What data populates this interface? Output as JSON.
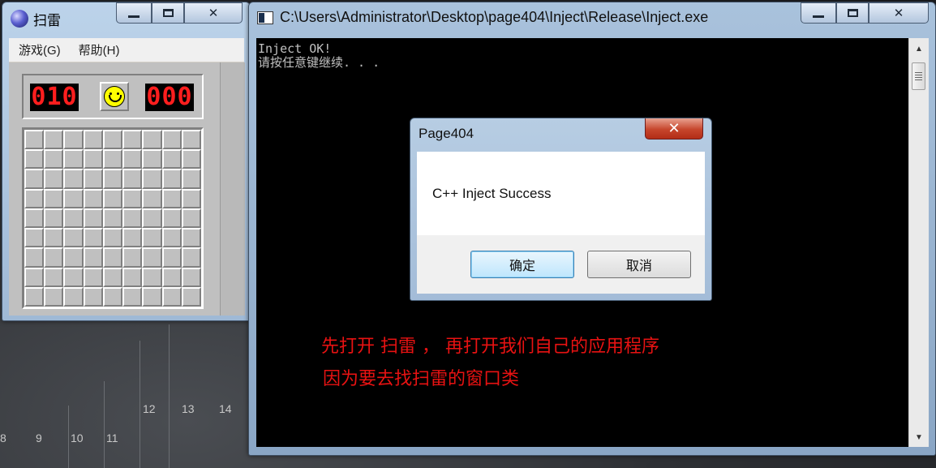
{
  "desktop": {
    "ruler_numbers": [
      "8",
      "9",
      "10",
      "11",
      "12",
      "13",
      "14"
    ]
  },
  "minesweeper": {
    "title": "扫雷",
    "menu": [
      "游戏(G)",
      "帮助(H)"
    ],
    "mine_counter": "010",
    "timer": "000",
    "grid_rows": 9,
    "grid_cols": 9
  },
  "console": {
    "title": "C:\\Users\\Administrator\\Desktop\\page404\\Inject\\Release\\Inject.exe",
    "lines": [
      "Inject OK!",
      "请按任意键继续. . ."
    ],
    "annotation_line1": "先打开  扫雷  ，  再打开我们自己的应用程序",
    "annotation_line2": "因为要去找扫雷的窗口类"
  },
  "dialog": {
    "title": "Page404",
    "message": "C++ Inject Success",
    "ok_label": "确定",
    "cancel_label": "取消"
  },
  "colors": {
    "annotation": "#e81212",
    "console_bg": "#000000",
    "lcd_red": "#ff1e1e"
  }
}
